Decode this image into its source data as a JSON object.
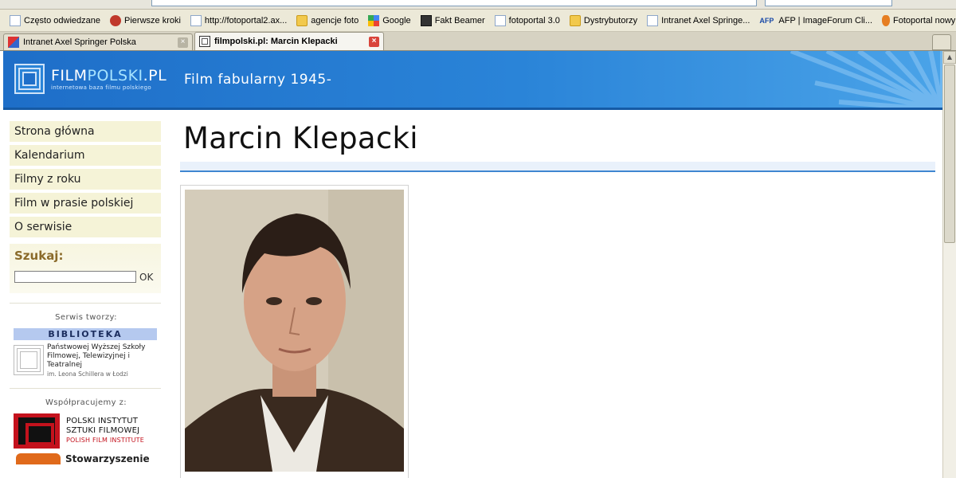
{
  "browser": {
    "bookmarks": [
      {
        "label": "Często odwiedzane",
        "icon": "page-icon"
      },
      {
        "label": "Pierwsze kroki",
        "icon": "firefox-icon"
      },
      {
        "label": "http://fotoportal2.ax...",
        "icon": "page-icon"
      },
      {
        "label": "agencje foto",
        "icon": "folder-icon"
      },
      {
        "label": "Google",
        "icon": "google-icon"
      },
      {
        "label": "Fakt Beamer",
        "icon": "dark-icon"
      },
      {
        "label": "fotoportal 3.0",
        "icon": "page-icon"
      },
      {
        "label": "Dystrybutorzy",
        "icon": "folder-icon"
      },
      {
        "label": "Intranet Axel Springe...",
        "icon": "page-icon"
      },
      {
        "label": "AFP | ImageForum Cli...",
        "icon": "afp-icon"
      },
      {
        "label": "Fotoportal nowy!",
        "icon": "flame-icon"
      }
    ],
    "tabs": [
      {
        "label": "Intranet Axel Springer Polska",
        "active": false
      },
      {
        "label": "filmpolski.pl: Marcin Klepacki",
        "active": true
      }
    ]
  },
  "site": {
    "logo_main_prefix": "FILM",
    "logo_main_highlight": "POLSKI",
    "logo_main_suffix": ".PL",
    "logo_tagline": "internetowa baza filmu polskiego",
    "subtitle": "Film fabularny 1945-"
  },
  "sidebar": {
    "nav": [
      "Strona główna",
      "Kalendarium",
      "Filmy z roku",
      "Film w prasie polskiej",
      "O serwisie"
    ],
    "search_label": "Szukaj:",
    "search_button": "OK",
    "created_by_title": "Serwis tworzy:",
    "library_header": "BIBLIOTEKA",
    "library_name": "Państwowej Wyższej Szkoły Filmowej, Telewizyjnej i Teatralnej",
    "library_sub": "im. Leona Schillera w Łodzi",
    "partners_title": "Współpracujemy z:",
    "pisf_line1": "POLSKI INSTYTUT",
    "pisf_line2": "SZTUKI FILMOWEJ",
    "pisf_line3": "POLISH FILM INSTITUTE",
    "stow_text": "Stowarzyszenie"
  },
  "main": {
    "title": "Marcin Klepacki",
    "photo_alt": "Marcin Klepacki portrait"
  },
  "colors": {
    "header_blue": "#2a84d8",
    "nav_bg": "#f5f3d7",
    "accent_line": "#3f86d1",
    "pisf_red": "#c4121d"
  }
}
